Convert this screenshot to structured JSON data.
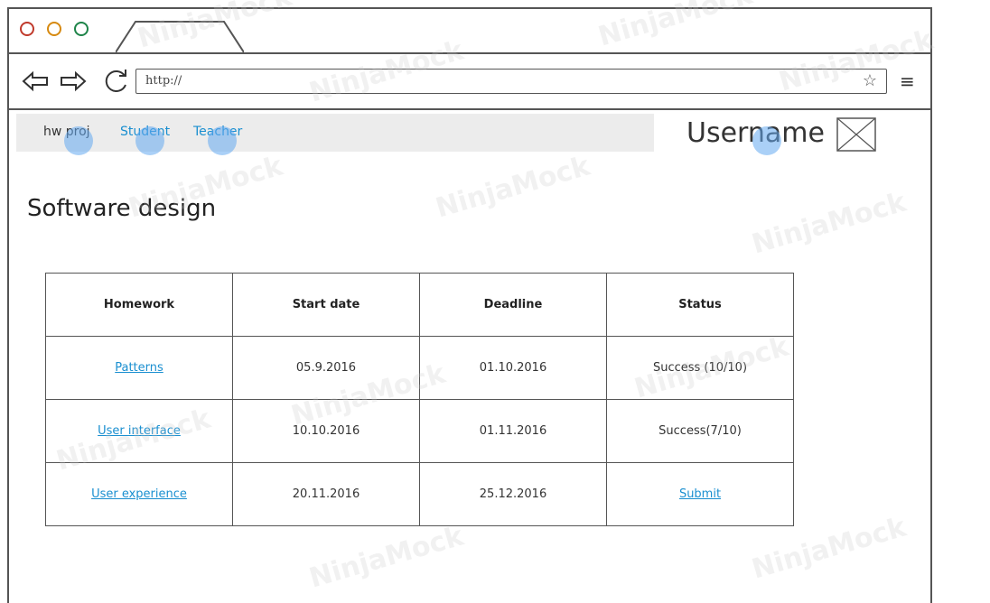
{
  "browser": {
    "url": "http://",
    "menu_glyph": "≡",
    "star_glyph": "☆"
  },
  "nav": {
    "brand": "hw proj",
    "links": [
      "Student",
      "Teacher"
    ]
  },
  "user": {
    "name": "Username"
  },
  "page": {
    "title": "Software design"
  },
  "table": {
    "headers": [
      "Homework",
      "Start date",
      "Deadline",
      "Status"
    ],
    "rows": [
      {
        "homework": "Patterns",
        "start": "05.9.2016",
        "deadline": "01.10.2016",
        "status": "Success (10/10)",
        "status_is_link": false
      },
      {
        "homework": "User interface",
        "start": "10.10.2016",
        "deadline": "01.11.2016",
        "status": "Success(7/10)",
        "status_is_link": false
      },
      {
        "homework": "User experience",
        "start": "20.11.2016",
        "deadline": "25.12.2016",
        "status": "Submit",
        "status_is_link": true
      }
    ]
  },
  "watermark": "NinjaMock",
  "colors": {
    "link": "#1a8fd0",
    "highlight": "#64aaf0",
    "nav_bg": "#ececec"
  }
}
